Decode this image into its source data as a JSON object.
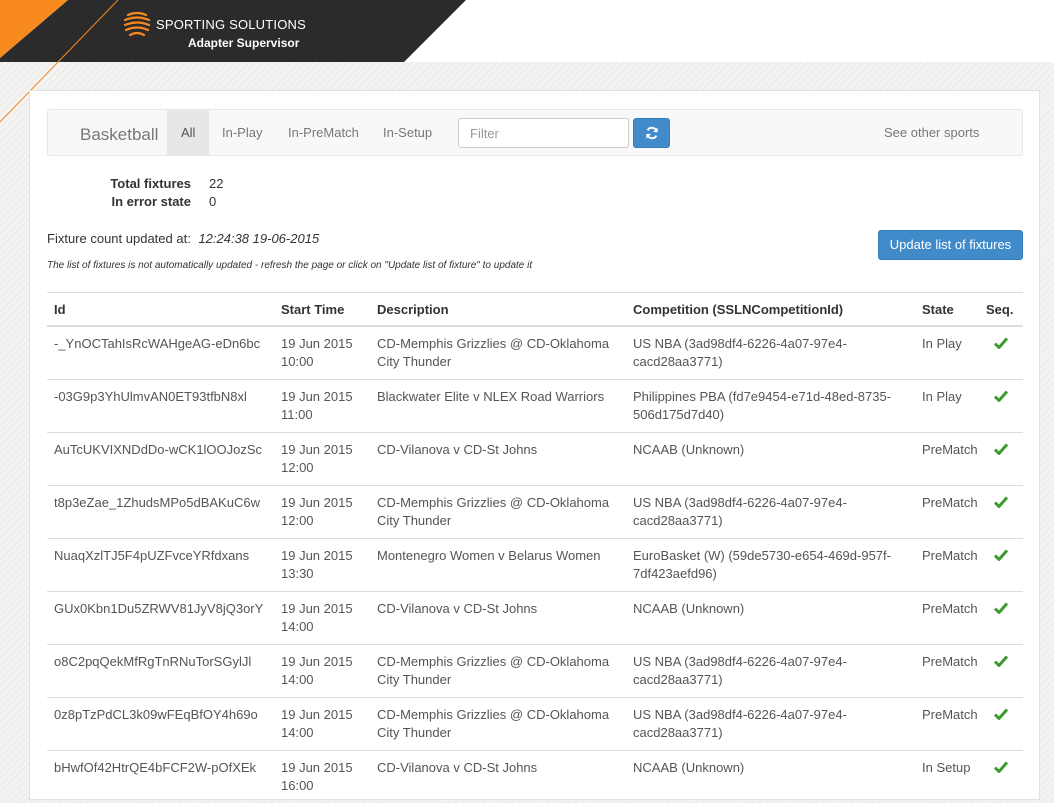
{
  "header": {
    "brand": "SPORTING SOLUTIONS",
    "app_title": "Adapter Supervisor"
  },
  "navbar": {
    "sport": "Basketball",
    "tabs": [
      {
        "label": "All",
        "active": true
      },
      {
        "label": "In-Play",
        "active": false
      },
      {
        "label": "In-PreMatch",
        "active": false
      },
      {
        "label": "In-Setup",
        "active": false
      }
    ],
    "filter_placeholder": "Filter",
    "other_sports": "See other sports"
  },
  "stats": {
    "total_label": "Total fixtures",
    "total_value": "22",
    "error_label": "In error state",
    "error_value": "0"
  },
  "update": {
    "count_label": "Fixture count updated at:",
    "count_time": "12:24:38 19-06-2015",
    "note": "The list of fixtures is not automatically updated - refresh the page or click on \"Update list of fixture\" to update it",
    "button": "Update list of fixtures"
  },
  "table": {
    "headers": {
      "id": "Id",
      "start": "Start Time",
      "description": "Description",
      "competition": "Competition (SSLNCompetitionId)",
      "state": "State",
      "seq": "Seq."
    },
    "rows": [
      {
        "id": "-_YnOCTahIsRcWAHgeAG-eDn6bc",
        "date": "19 Jun 2015",
        "time": "10:00",
        "description": "CD-Memphis Grizzlies @ CD-Oklahoma City Thunder",
        "competition": "US NBA (3ad98df4-6226-4a07-97e4-cacd28aa3771)",
        "state": "In Play"
      },
      {
        "id": "-03G9p3YhUlmvAN0ET93tfbN8xl",
        "date": "19 Jun 2015",
        "time": "11:00",
        "description": "Blackwater Elite v NLEX Road Warriors",
        "competition": "Philippines PBA (fd7e9454-e71d-48ed-8735-506d175d7d40)",
        "state": "In Play"
      },
      {
        "id": "AuTcUKVIXNDdDo-wCK1lOOJozSc",
        "date": "19 Jun 2015",
        "time": "12:00",
        "description": "CD-Vilanova v CD-St Johns",
        "competition": "NCAAB (Unknown)",
        "state": "PreMatch"
      },
      {
        "id": "t8p3eZae_1ZhudsMPo5dBAKuC6w",
        "date": "19 Jun 2015",
        "time": "12:00",
        "description": "CD-Memphis Grizzlies @ CD-Oklahoma City Thunder",
        "competition": "US NBA (3ad98df4-6226-4a07-97e4-cacd28aa3771)",
        "state": "PreMatch"
      },
      {
        "id": "NuaqXzlTJ5F4pUZFvceYRfdxans",
        "date": "19 Jun 2015",
        "time": "13:30",
        "description": "Montenegro Women v Belarus Women",
        "competition": "EuroBasket (W) (59de5730-e654-469d-957f-7df423aefd96)",
        "state": "PreMatch"
      },
      {
        "id": "GUx0Kbn1Du5ZRWV81JyV8jQ3orY",
        "date": "19 Jun 2015",
        "time": "14:00",
        "description": "CD-Vilanova v CD-St Johns",
        "competition": "NCAAB (Unknown)",
        "state": "PreMatch"
      },
      {
        "id": "o8C2pqQekMfRgTnRNuTorSGylJl",
        "date": "19 Jun 2015",
        "time": "14:00",
        "description": "CD-Memphis Grizzlies @ CD-Oklahoma City Thunder",
        "competition": "US NBA (3ad98df4-6226-4a07-97e4-cacd28aa3771)",
        "state": "PreMatch"
      },
      {
        "id": "0z8pTzPdCL3k09wFEqBfOY4h69o",
        "date": "19 Jun 2015",
        "time": "14:00",
        "description": "CD-Memphis Grizzlies @ CD-Oklahoma City Thunder",
        "competition": "US NBA (3ad98df4-6226-4a07-97e4-cacd28aa3771)",
        "state": "PreMatch"
      },
      {
        "id": "bHwfOf42HtrQE4bFCF2W-pOfXEk",
        "date": "19 Jun 2015",
        "time": "16:00",
        "description": "CD-Vilanova v CD-St Johns",
        "competition": "NCAAB (Unknown)",
        "state": "In Setup"
      }
    ]
  },
  "colors": {
    "accent_orange": "#f7891f",
    "header_dark": "#2b2b2b",
    "primary_blue": "#428bca",
    "check_green": "#3c9a2f"
  }
}
